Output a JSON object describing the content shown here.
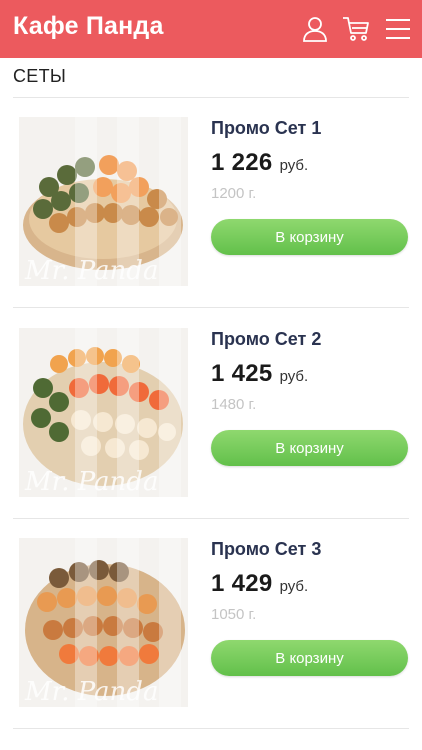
{
  "header": {
    "brand": "Кафе Панда",
    "background_color": "#ec5a5e",
    "icons": [
      "user-icon",
      "cart-icon",
      "menu-icon"
    ]
  },
  "section": {
    "title": "СЕТЫ"
  },
  "products": [
    {
      "name": "Промо Сет 1",
      "price": "1 226",
      "currency": "руб.",
      "weight": "1200 г.",
      "button_label": "В корзину",
      "image_watermark": "Mr. Panda"
    },
    {
      "name": "Промо Сет 2",
      "price": "1 425",
      "currency": "руб.",
      "weight": "1480 г.",
      "button_label": "В корзину",
      "image_watermark": "Mr. Panda"
    },
    {
      "name": "Промо Сет 3",
      "price": "1 429",
      "currency": "руб.",
      "weight": "1050 г.",
      "button_label": "В корзину",
      "image_watermark": "Mr. Panda"
    }
  ],
  "colors": {
    "accent": "#ec5a5e",
    "button": "#6cc552",
    "product_name": "#2a3350"
  }
}
